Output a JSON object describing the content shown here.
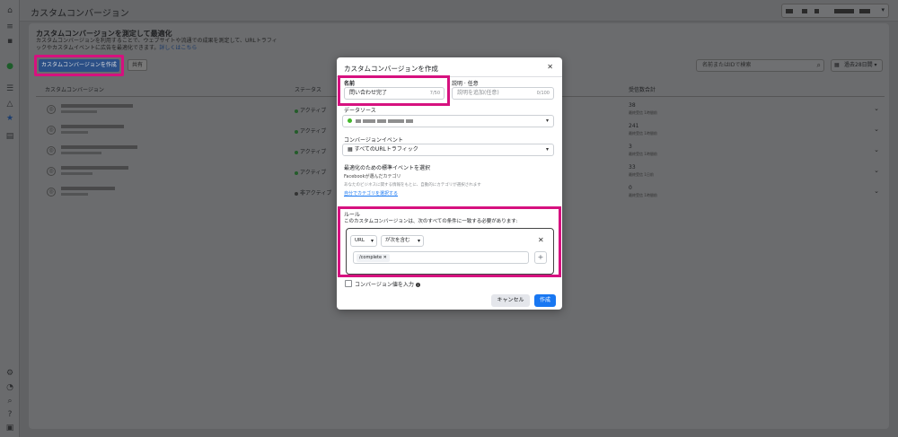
{
  "app": {
    "page_title": "カスタムコンバージョン",
    "header_title": "カスタムコンバージョンを測定して最適化",
    "header_desc": "カスタムコンバージョンを利用することで、ウェブサイトや流通での成果を測定して、URLトラフィックやカスタムイベントに広告を最適化できます。",
    "header_link": "詳しくはこちら",
    "create_button": "カスタムコンバージョンを作成",
    "share_button": "共有",
    "search_placeholder": "名前またはIDで検索",
    "date_range": "過去28日間"
  },
  "table": {
    "headers": [
      "カスタムコンバージョン",
      "ステータス",
      "受信数合計"
    ],
    "rows": [
      {
        "status": "アクティブ",
        "count": "38",
        "count_sub": "最終受信 1時間前"
      },
      {
        "status": "アクティブ",
        "count": "241",
        "count_sub": "最終受信 1時間前"
      },
      {
        "status": "アクティブ",
        "count": "3",
        "count_sub": "最終受信 1時間前"
      },
      {
        "status": "アクティブ",
        "count": "33",
        "count_sub": "最終受信 1日前"
      },
      {
        "status": "非アクティブ",
        "count": "0",
        "count_sub": "最終受信 1時間前"
      }
    ]
  },
  "modal": {
    "title": "カスタムコンバージョンを作成",
    "name_label": "名前",
    "name_value": "問い合わせ完了",
    "name_count": "7/50",
    "desc_label": "説明 · 任意",
    "desc_placeholder": "説明を追加(任意)",
    "desc_count": "0/100",
    "datasource_label": "データソース",
    "event_label": "コンバージョンイベント",
    "event_value": "すべてのURLトラフィック",
    "opt_label": "最適化のための標準イベントを選択",
    "opt_sub": "Facebookが選んだカテゴリ",
    "opt_hint": "あなたのビジネスに関する情報をもとに、自動的にカテゴリが選択されます",
    "opt_link": "自分でカテゴリを選択する",
    "rule_label": "ルール",
    "rule_desc": "このカスタムコンバージョンは、次のすべての条件に一致する必要があります:",
    "rule_field": "URL",
    "rule_op": "が次を含む",
    "rule_tag": "/complete",
    "value_checkbox": "コンバージョン値を入力",
    "cancel": "キャンセル",
    "create": "作成"
  },
  "icons": {
    "close": "close-icon",
    "search": "search-icon",
    "calendar": "calendar-icon",
    "plus": "plus-icon"
  },
  "colors": {
    "highlight": "#d6117f",
    "primary": "#1877f2",
    "active_dot": "#42b72a"
  }
}
